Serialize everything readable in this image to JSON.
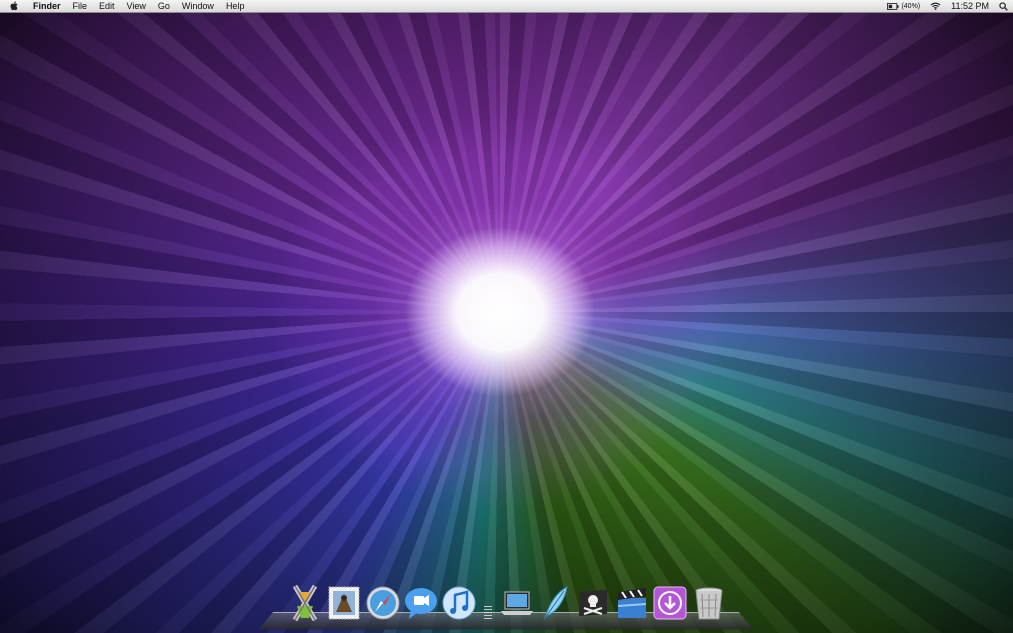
{
  "menubar": {
    "apple_icon": "apple-logo-icon",
    "app_name": "Finder",
    "menus": [
      "File",
      "Edit",
      "View",
      "Go",
      "Window",
      "Help"
    ],
    "battery_icon": "battery-icon",
    "battery_percent": "(40%)",
    "wifi_icon": "wifi-icon",
    "clock": "11:52 PM",
    "spotlight_icon": "spotlight-search-icon"
  },
  "desktop": {
    "wallpaper": "purple-green starburst",
    "colors": {
      "purple": "#8a3ab0",
      "green": "#3f7d1f",
      "blue": "#3740b8",
      "glow": "#ffffff"
    }
  },
  "dock": {
    "items": [
      {
        "name": "Xcode-like app",
        "icon": "x-app-icon"
      },
      {
        "name": "Mail",
        "icon": "mail-stamp-icon"
      },
      {
        "name": "Safari",
        "icon": "safari-compass-icon"
      },
      {
        "name": "iChat",
        "icon": "ichat-video-icon"
      },
      {
        "name": "iTunes",
        "icon": "itunes-note-icon"
      },
      {
        "name": "Finder",
        "icon": "laptop-icon"
      },
      {
        "name": "Quill",
        "icon": "feather-icon"
      },
      {
        "name": "Pirate app",
        "icon": "pirate-flag-icon"
      },
      {
        "name": "Movie",
        "icon": "clapperboard-icon"
      },
      {
        "name": "Downloads",
        "icon": "download-arrow-icon"
      },
      {
        "name": "Trash",
        "icon": "trash-icon"
      }
    ]
  }
}
